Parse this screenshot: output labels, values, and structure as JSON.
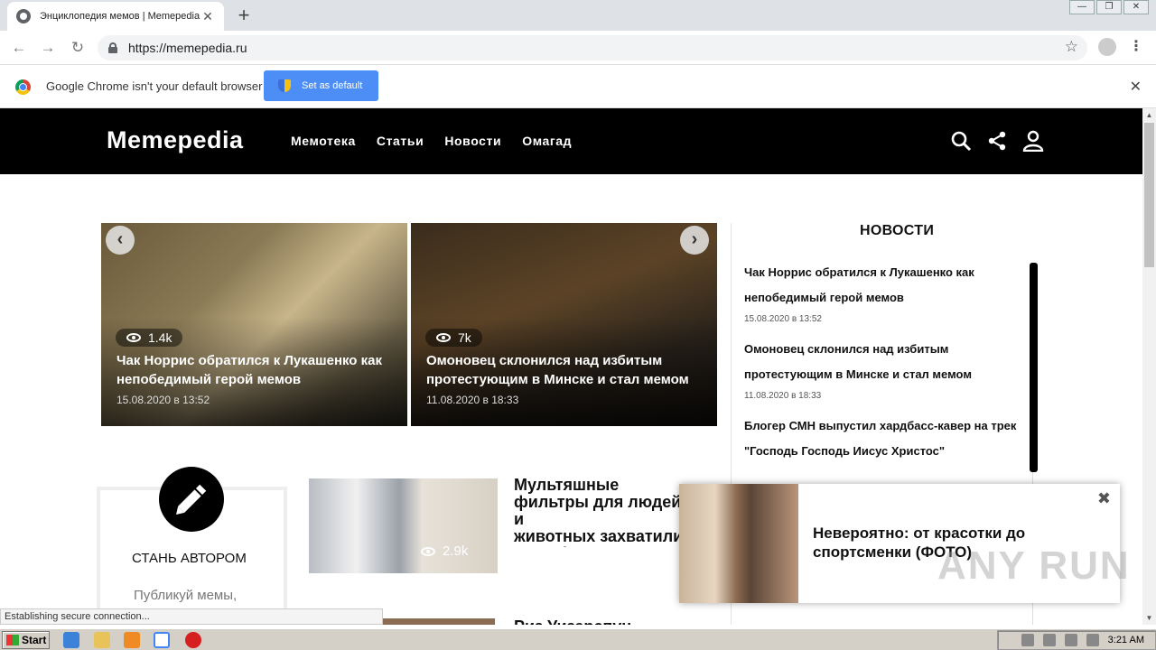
{
  "browser": {
    "tab_title": "Энциклопедия мемов | Memepedia",
    "tab_close": "✕",
    "new_tab": "+",
    "url": "https://memepedia.ru",
    "window_controls": [
      "—",
      "❐",
      "✕"
    ],
    "nav": {
      "back": "←",
      "forward": "→",
      "reload": "↻"
    },
    "star": "☆",
    "menu": "⋮"
  },
  "infobar": {
    "message": "Google Chrome isn't your default browser",
    "button_label": "Set as default",
    "close": "✕"
  },
  "site": {
    "logo": "Memepedia",
    "nav": [
      "Мемотека",
      "Статьи",
      "Новости",
      "Омагад"
    ],
    "icons": [
      "search-icon",
      "share-icon",
      "user-icon"
    ]
  },
  "slider": {
    "prev": "‹",
    "next": "›",
    "slides": [
      {
        "views": "1.4k",
        "title": "Чак Норрис обратился к Лукашенко как непобедимый герой мемов",
        "date": "15.08.2020 в 13:52"
      },
      {
        "views": "7k",
        "title": "Омоновец склонился над избитым протестующим в Минске и стал мемом",
        "date": "11.08.2020 в 18:33"
      }
    ]
  },
  "news": {
    "heading": "НОВОСТИ",
    "items": [
      {
        "title": "Чак Норрис обратился к Лукашенко как непобедимый герой мемов",
        "date": "15.08.2020 в 13:52"
      },
      {
        "title": "Омоновец склонился над избитым протестующим в Минске и стал мемом",
        "date": "11.08.2020 в 18:33"
      },
      {
        "title": "Блогер СМН выпустил хардбасс-кавер на трек \"Господь Господь Иисус Христос\"",
        "date": ""
      }
    ]
  },
  "author": {
    "title": "СТАНЬ АВТОРОМ",
    "subtitle": "Публикуй мемы,"
  },
  "articles": [
    {
      "views": "2.9k",
      "title": "Мультяшные\nфильтры для людей и\nживотных захватили\nSnapchat"
    },
    {
      "title": "Риз Уизерспун"
    }
  ],
  "popup": {
    "text": "Невероятно: от красотки до спортсменки (ФОТО)",
    "close": "✖"
  },
  "watermark": "ANY RUN",
  "status": "Establishing secure connection...",
  "taskbar": {
    "start": "Start",
    "clock": "3:21 AM"
  },
  "colors": {
    "header_bg": "#000000",
    "infobar_button": "#4c8ef5",
    "tabstrip": "#dee1e6"
  }
}
